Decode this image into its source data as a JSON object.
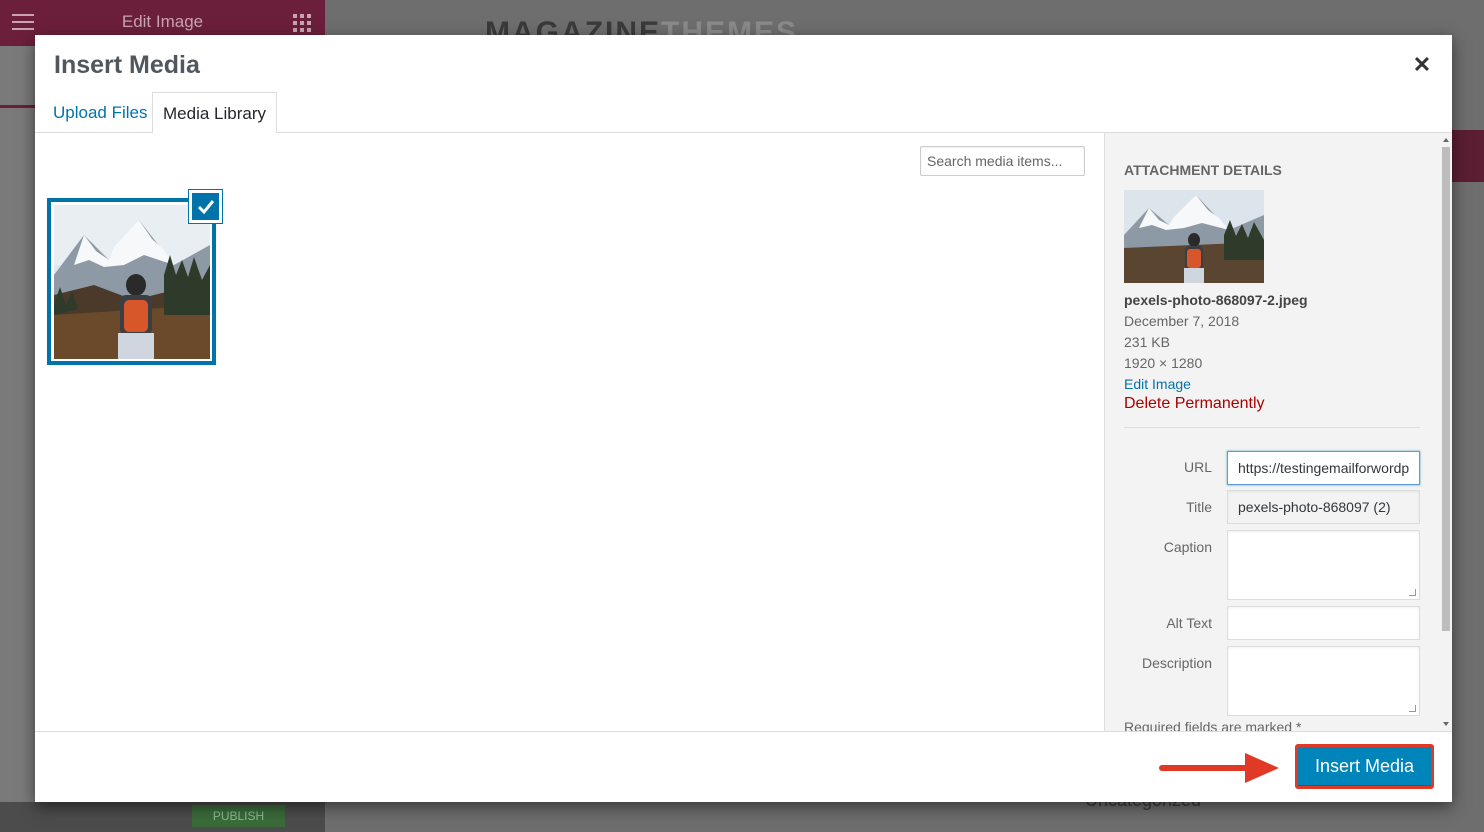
{
  "background": {
    "panel_title": "Edit Image",
    "site_logo_dark": "MAGAZINE",
    "site_logo_light": "THEMES",
    "publish_label": "PUBLISH",
    "category_text": "Uncategorized"
  },
  "modal": {
    "title": "Insert Media",
    "close_glyph": "✕",
    "tabs": [
      {
        "label": "Upload Files",
        "active": false
      },
      {
        "label": "Media Library",
        "active": true
      }
    ],
    "search": {
      "placeholder": "Search media items...",
      "value": ""
    }
  },
  "attachment_details": {
    "heading": "ATTACHMENT DETAILS",
    "filename": "pexels-photo-868097-2.jpeg",
    "date": "December 7, 2018",
    "size": "231 KB",
    "dimensions": "1920 × 1280",
    "edit_link": "Edit Image",
    "delete_link": "Delete Permanently",
    "fields": {
      "url": {
        "label": "URL",
        "value": "https://testingemailforwordp"
      },
      "title": {
        "label": "Title",
        "value": "pexels-photo-868097 (2)"
      },
      "caption": {
        "label": "Caption",
        "value": ""
      },
      "alt_text": {
        "label": "Alt Text",
        "value": ""
      },
      "description": {
        "label": "Description",
        "value": ""
      }
    },
    "required_note": "Required fields are marked *"
  },
  "toolbar": {
    "insert_label": "Insert Media"
  },
  "colors": {
    "accent": "#0073aa",
    "button": "#0085ba",
    "delete": "#aa0000",
    "highlight": "#e03a26",
    "elementor": "#6b1f3a"
  },
  "icons": {
    "checkmark": "check-icon",
    "close": "close-icon",
    "arrow": "arrow-right-icon"
  }
}
